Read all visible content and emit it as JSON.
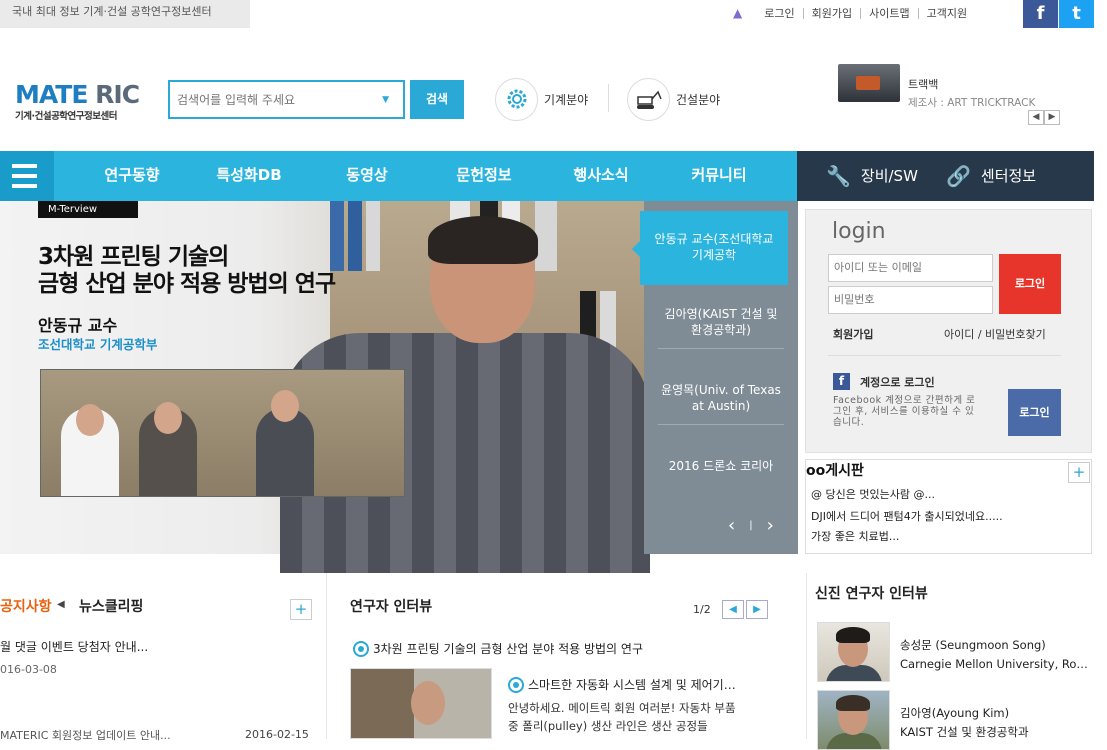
{
  "topbar": {
    "tagline": "국내 최대 정보 기계·건설 공학연구정보센터",
    "links": [
      "로그인",
      "회원가입",
      "사이트맵",
      "고객지원"
    ],
    "facebook": "f",
    "twitter": "t"
  },
  "header": {
    "logo_main": "MATE",
    "logo_accent": "RIC",
    "logo_sub": "기계·건설공학연구정보센터",
    "search_placeholder": "검색어를 입력해 주세요",
    "search_button": "검색",
    "field_machine": "기계분야",
    "field_construction": "건설분야",
    "product_name": "트랙백",
    "product_maker": "제조사 : ART TRICKTRACK"
  },
  "nav": {
    "items": [
      "연구동향",
      "특성화DB",
      "동영상",
      "문헌정보",
      "행사소식",
      "커뮤니티"
    ],
    "right_items": [
      "장비/SW",
      "센터정보"
    ]
  },
  "banner": {
    "label": "M-Terview",
    "title_line1": "3차원 프린팅 기술의",
    "title_line2": "금형 산업 분야 적용 방법의 연구",
    "name": "안동규 교수",
    "affiliation": "조선대학교 기계공학부",
    "side_items": [
      "안동규 교수(조선대학교 기계공학",
      "김아영(KAIST 건설 및 환경공학과)",
      "윤영목(Univ. of Texas at Austin)",
      "2016 드론쇼 코리아"
    ],
    "prev": "‹",
    "next": "›",
    "divider": "|"
  },
  "login": {
    "title": "login",
    "id_placeholder": "아이디 또는 이메일",
    "pw_placeholder": "비밀번호",
    "button": "로그인",
    "join": "회원가입",
    "find": "아이디 / 비밀번호찾기",
    "fb_title": "계정으로 로그인",
    "fb_desc": "Facebook 계정으로 간편하게 로그인 후, 서비스를 이용하실 수 있습니다.",
    "fb_button": "로그인"
  },
  "board": {
    "title": "oo게시판",
    "plus": "+",
    "items": [
      "@ 당신은 멋있는사람 @...",
      "DJI에서 드디어 팬텀4가 출시되었네요.....",
      "가장 좋은 치료법..."
    ]
  },
  "notice": {
    "tab_active": "공지사항",
    "tab_other": "뉴스클리핑",
    "plus": "+",
    "item1": "월 댓글 이벤트 당첨자 안내...",
    "date1": "016-03-08",
    "item2": "MATERIC 회원정보 업데이트 안내...",
    "date2": "2016-02-15"
  },
  "research": {
    "title": "연구자 인터뷰",
    "page": "1/2",
    "top_item": "3차원 프린팅 기술의 금형 산업 분야 적용 방법의 연구",
    "sub_title": "스마트한 자동화 시스템 설계 및 제어기…",
    "sub_desc": "안녕하세요. 메이트릭 회원 여러분!   자동차 부품 중 폴리(pulley) 생산 라인은 생산 공정들"
  },
  "newcomer": {
    "title": "신진 연구자 인터뷰",
    "people": [
      {
        "name": "송성문 (Seungmoon Song)",
        "affiliation": "Carnegie Mellon University, Ro…"
      },
      {
        "name": "김아영(Ayoung Kim)",
        "affiliation": "KAIST 건설 및 환경공학과"
      }
    ]
  },
  "colors": {
    "accent": "#2bb4de",
    "dark_nav": "#27384a",
    "login_red": "#e8352b",
    "notice_orange": "#e8610f"
  }
}
